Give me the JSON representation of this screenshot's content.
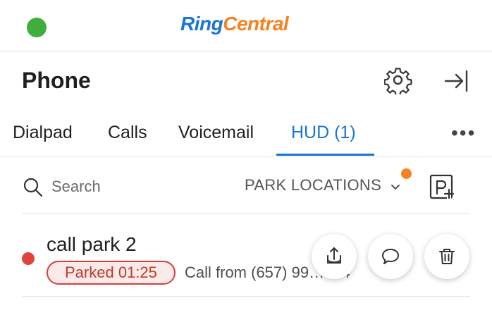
{
  "brand": {
    "logo_part1": "Ring",
    "logo_part2": "Central",
    "status_color": "#3fae3f",
    "ring_color": "#1976d2",
    "central_color": "#f58220"
  },
  "header": {
    "title": "Phone",
    "settings_icon": "gear-icon",
    "collapse_icon": "collapse-panel-icon"
  },
  "tabs": [
    {
      "label": "Dialpad",
      "active": false
    },
    {
      "label": "Calls",
      "active": false
    },
    {
      "label": "Voicemail",
      "active": false
    },
    {
      "label": "HUD (1)",
      "active": true
    }
  ],
  "more_label": "•••",
  "search": {
    "placeholder": "Search",
    "value": ""
  },
  "filter": {
    "label": "PARK LOCATIONS",
    "indicator_color": "#f58220"
  },
  "park_list": [
    {
      "title": "call park 2",
      "presence_color": "#e0433b",
      "status_badge": "Parked 01:25",
      "detail": "Call from (657) 99…694",
      "actions": [
        "pickup-icon",
        "message-icon",
        "trash-icon"
      ]
    }
  ]
}
